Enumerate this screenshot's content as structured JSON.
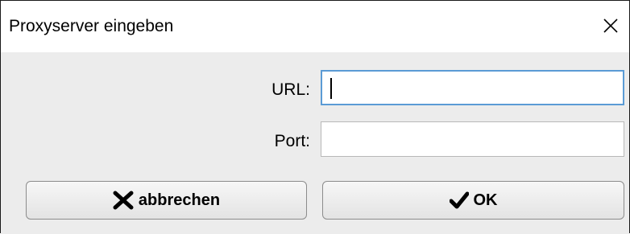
{
  "window": {
    "title": "Proxyserver eingeben",
    "close_icon": "close-icon"
  },
  "form": {
    "url": {
      "label": "URL:",
      "value": "",
      "focused": true
    },
    "port": {
      "label": "Port:",
      "value": ""
    }
  },
  "buttons": {
    "cancel": {
      "label": "abbrechen",
      "icon": "x-mark-icon"
    },
    "ok": {
      "label": "OK",
      "icon": "checkmark-icon"
    }
  },
  "colors": {
    "focus_border": "#5b9bd5",
    "dialog_background": "#ececec",
    "titlebar_background": "#ffffff"
  }
}
